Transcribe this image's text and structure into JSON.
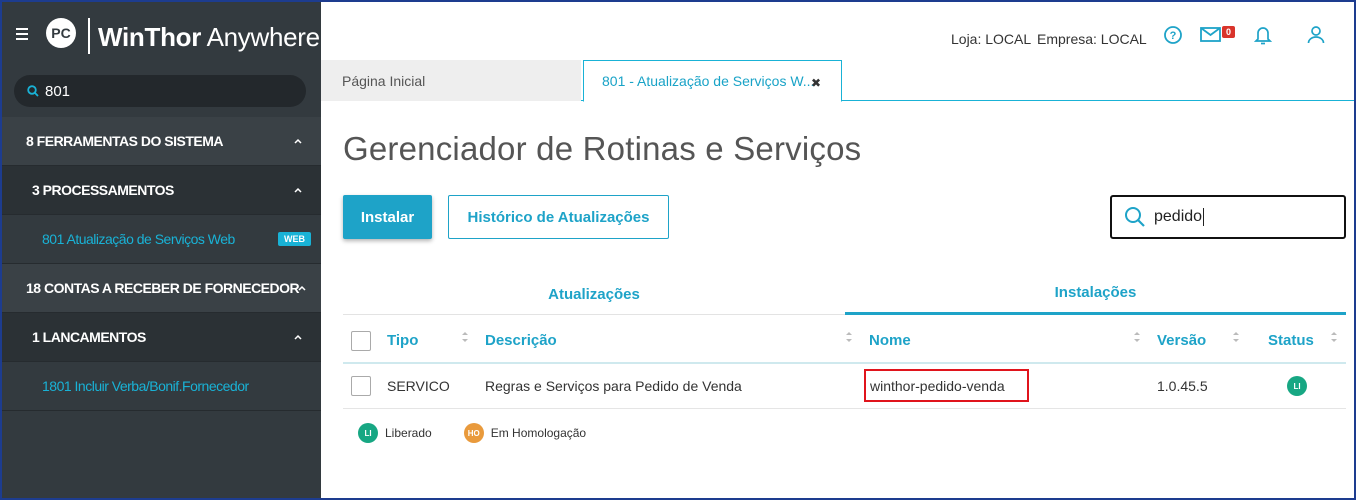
{
  "app": {
    "brand_bold": "WinThor",
    "brand_light": " Anywhere",
    "logo_text": "PC"
  },
  "sidebar": {
    "search_value": "801",
    "items": [
      {
        "label": "8  FERRAMENTAS DO SISTEMA"
      },
      {
        "label": "3  PROCESSAMENTOS"
      },
      {
        "label": "801  Atualização de Serviços Web",
        "badge": "WEB"
      },
      {
        "label": "18  CONTAS A RECEBER DE FORNECEDOR"
      },
      {
        "label": "1  LANCAMENTOS"
      },
      {
        "label": "1801  Incluir Verba/Bonif.Fornecedor"
      }
    ]
  },
  "header": {
    "loja": "Loja: LOCAL",
    "empresa": "Empresa: LOCAL",
    "mail_count": "0"
  },
  "tabs": [
    {
      "label": "Página Inicial"
    },
    {
      "label": "801 - Atualização de Serviços W...",
      "close": "✖"
    }
  ],
  "main": {
    "title": "Gerenciador de Rotinas e Serviços",
    "install_button": "Instalar",
    "history_button": "Histórico de Atualizações",
    "search_value": "pedido",
    "subtabs": [
      "Atualizações",
      "Instalações"
    ],
    "columns": [
      "Tipo",
      "Descrição",
      "Nome",
      "Versão",
      "Status"
    ],
    "rows": [
      {
        "tipo": "SERVICO",
        "descricao": "Regras e Serviços para Pedido de Venda",
        "nome": "winthor-pedido-venda",
        "versao": "1.0.45.5",
        "status": "LI"
      }
    ],
    "legend": [
      {
        "code": "LI",
        "label": "Liberado",
        "color": "#17a783"
      },
      {
        "code": "HO",
        "label": "Em Homologação",
        "color": "#e99a3c"
      }
    ]
  },
  "colors": {
    "accent": "#1ea3c8",
    "sidebar": "#333a3f",
    "highlight": "#e0141c"
  }
}
